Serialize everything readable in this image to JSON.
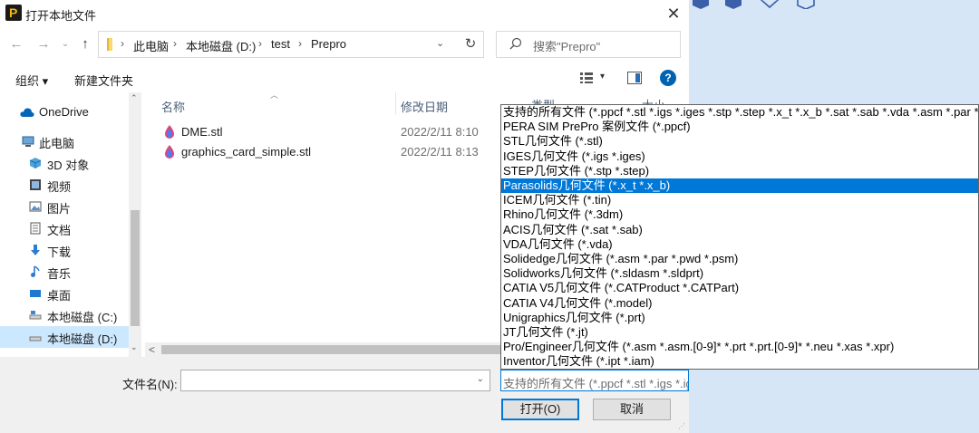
{
  "window": {
    "title": "打开本地文件",
    "close_glyph": "✕"
  },
  "nav": {
    "back": "←",
    "forward": "→",
    "up": "↑",
    "refresh": "↻",
    "address_dropdown": "⌄"
  },
  "breadcrumb": [
    "此电脑",
    "本地磁盘 (D:)",
    "test",
    "Prepro"
  ],
  "breadcrumb_separator": "›",
  "search": {
    "placeholder": "搜索\"Prepro\""
  },
  "toolbar": {
    "organize": "组织 ▾",
    "new_folder": "新建文件夹",
    "view_dropdown": "▾",
    "help": "?"
  },
  "sidebar": {
    "items": [
      {
        "label": "OneDrive",
        "icon": "cloud-icon"
      },
      {
        "label": "此电脑",
        "icon": "computer-icon"
      },
      {
        "label": "3D 对象",
        "icon": "cube-icon"
      },
      {
        "label": "视频",
        "icon": "video-icon"
      },
      {
        "label": "图片",
        "icon": "picture-icon"
      },
      {
        "label": "文档",
        "icon": "document-icon"
      },
      {
        "label": "下载",
        "icon": "download-icon"
      },
      {
        "label": "音乐",
        "icon": "music-icon"
      },
      {
        "label": "桌面",
        "icon": "desktop-icon"
      },
      {
        "label": "本地磁盘 (C:)",
        "icon": "drive-icon"
      },
      {
        "label": "本地磁盘 (D:)",
        "icon": "drive-icon",
        "selected": true
      }
    ],
    "scroll_up": "⌃",
    "scroll_down": "⌄"
  },
  "columns": {
    "name": "名称",
    "modified": "修改日期",
    "type": "类型",
    "size": "大小"
  },
  "files": [
    {
      "name": "DME.stl",
      "modified": "2022/2/11 8:10",
      "icon": "stl-file-icon"
    },
    {
      "name": "graphics_card_simple.stl",
      "modified": "2022/2/11 8:13",
      "icon": "stl-file-icon"
    }
  ],
  "hscroll_left": "<",
  "bottom": {
    "filename_label": "文件名(N):",
    "filename_value": "",
    "filetype_selected": "支持的所有文件 (*.ppcf *.stl *.igs *.iges *.stp *.step *.x_t *.x_b *.sat *.sab *.vda *.asm *.par *.p",
    "open_button": "打开(O)",
    "cancel_button": "取消",
    "dropdown_glyph": "⌄"
  },
  "filetype_options": [
    "支持的所有文件 (*.ppcf *.stl *.igs *.iges *.stp *.step *.x_t *.x_b *.sat *.sab *.vda *.asm *.par *.p",
    "PERA SIM PrePro 案例文件 (*.ppcf)",
    "STL几何文件 (*.stl)",
    "IGES几何文件 (*.igs *.iges)",
    "STEP几何文件 (*.stp *.step)",
    "Parasolids几何文件 (*.x_t *.x_b)",
    "ICEM几何文件 (*.tin)",
    "Rhino几何文件 (*.3dm)",
    "ACIS几何文件 (*.sat *.sab)",
    "VDA几何文件 (*.vda)",
    "Solidedge几何文件 (*.asm *.par *.pwd *.psm)",
    "Solidworks几何文件 (*.sldasm *.sldprt)",
    "CATIA V5几何文件 (*.CATProduct *.CATPart)",
    "CATIA V4几何文件 (*.model)",
    "Unigraphics几何文件 (*.prt)",
    "JT几何文件 (*.jt)",
    "Pro/Engineer几何文件 (*.asm *.asm.[0-9]* *.prt *.prt.[0-9]* *.neu *.xas *.xpr)",
    "Inventor几何文件 (*.ipt *.iam)"
  ],
  "filetype_selected_index": 5,
  "colors": {
    "accent": "#0078d7",
    "selection": "#cce8ff",
    "background_app": "#d7e6f7"
  }
}
